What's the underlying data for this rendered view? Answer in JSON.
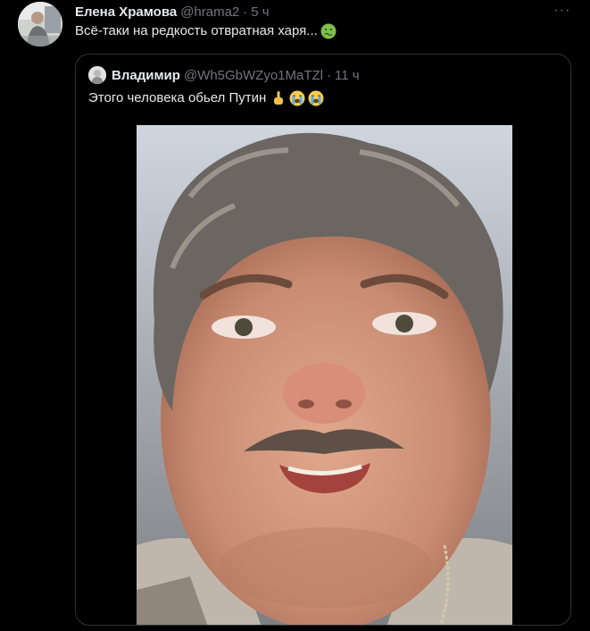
{
  "tweet": {
    "author_name": "Елена Храмова",
    "author_handle": "@hrama2",
    "separator": "·",
    "timestamp": "5 ч",
    "text": "Всё-таки на редкость отвратная харя...",
    "emoji": "nauseated-face-emoji",
    "more_icon": "more-horizontal-icon",
    "more_label": "···"
  },
  "quote": {
    "author_name": "Владимир",
    "author_handle": "@Wh5GbWZyo1MaTZl",
    "separator": "·",
    "timestamp": "11 ч",
    "text": "Этого человека обьел Путин",
    "emojis": [
      "index-pointing-up-emoji",
      "loudly-crying-face-emoji",
      "loudly-crying-face-emoji"
    ],
    "media_alt": "photo-close-up-face"
  },
  "colors": {
    "background": "#000000",
    "text_primary": "#e7e9ea",
    "text_secondary": "#71767b",
    "border": "#2f3336"
  }
}
